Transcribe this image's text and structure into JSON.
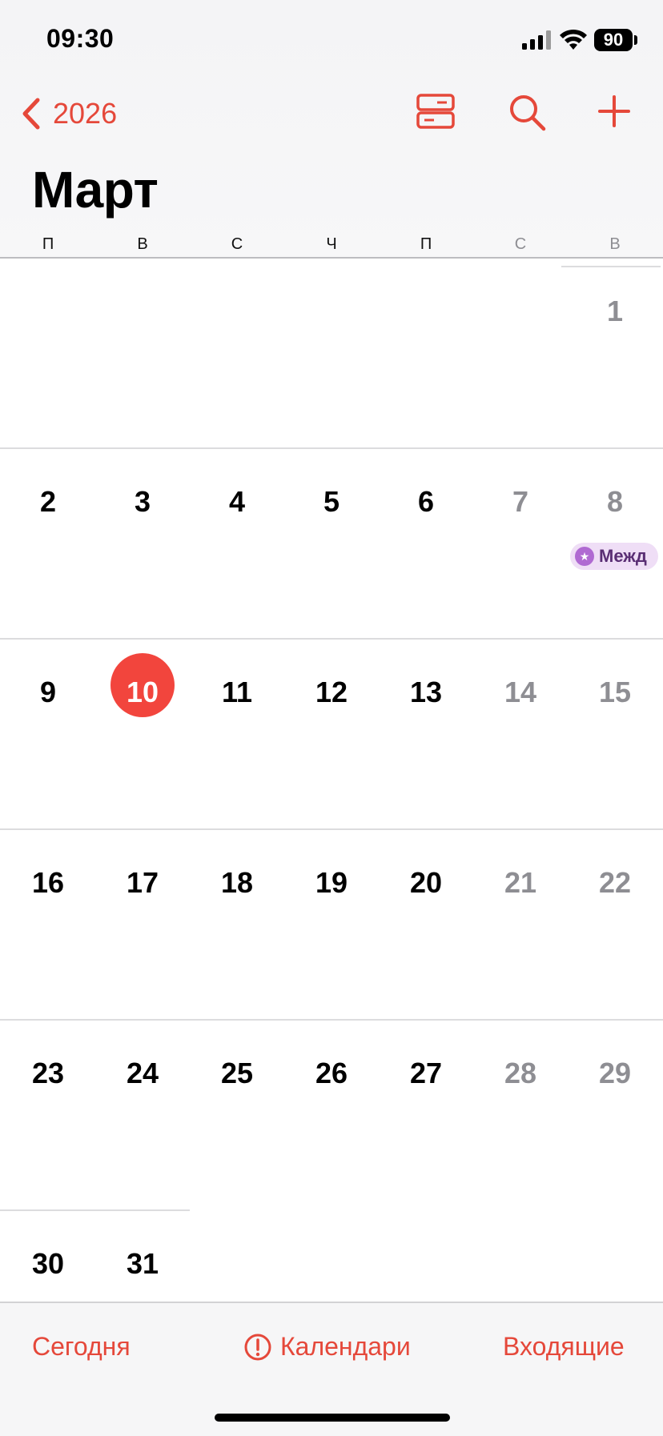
{
  "status_bar": {
    "time": "09:30",
    "battery": "90"
  },
  "nav": {
    "back_label": "2026"
  },
  "month_title": "Март",
  "weekdays": [
    "П",
    "В",
    "С",
    "Ч",
    "П",
    "С",
    "В"
  ],
  "weeks": [
    [
      "",
      "",
      "",
      "",
      "",
      "",
      "1"
    ],
    [
      "2",
      "3",
      "4",
      "5",
      "6",
      "7",
      "8"
    ],
    [
      "9",
      "10",
      "11",
      "12",
      "13",
      "14",
      "15"
    ],
    [
      "16",
      "17",
      "18",
      "19",
      "20",
      "21",
      "22"
    ],
    [
      "23",
      "24",
      "25",
      "26",
      "27",
      "28",
      "29"
    ],
    [
      "30",
      "31",
      "",
      "",
      "",
      "",
      ""
    ]
  ],
  "today": "10",
  "event": {
    "date": "8",
    "title": "Межд",
    "color": "#b06ad2"
  },
  "toolbar": {
    "today": "Сегодня",
    "calendars": "Календари",
    "inbox": "Входящие"
  },
  "colors": {
    "accent": "#e5483a",
    "today_circle": "#f2453d"
  }
}
